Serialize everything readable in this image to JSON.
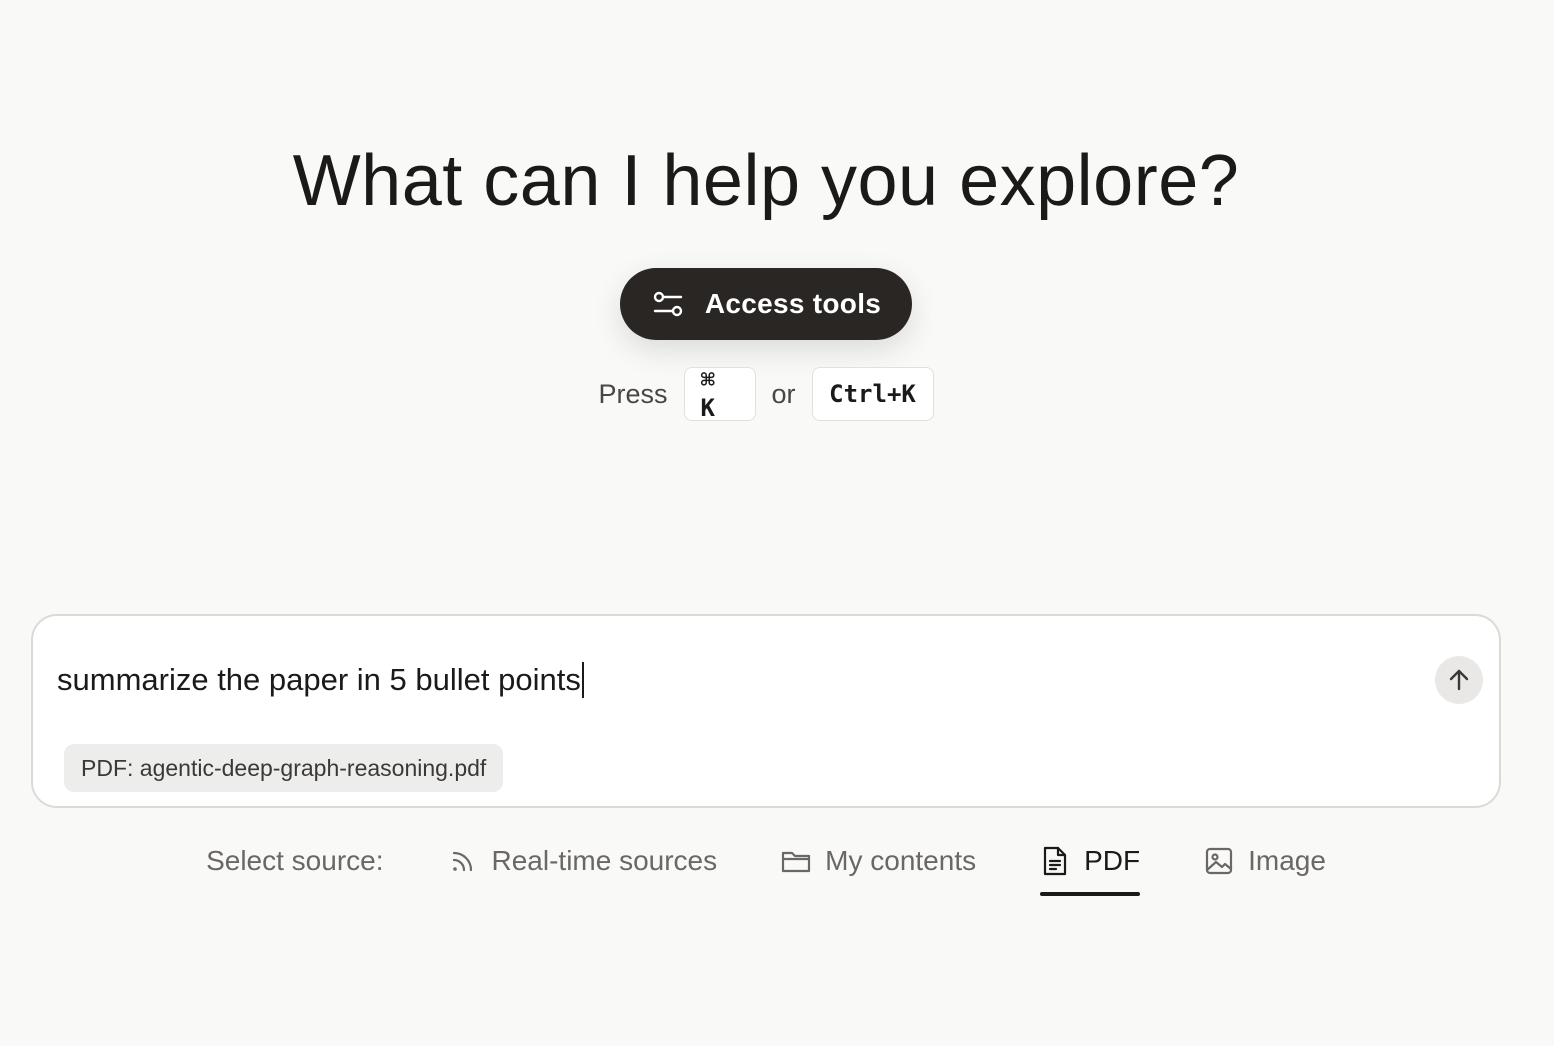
{
  "hero": {
    "title": "What can I help you explore?"
  },
  "tools_button": {
    "label": "Access tools",
    "icon": "sliders-icon"
  },
  "shortcut": {
    "press_label": "Press",
    "mac_key": "⌘ K",
    "or_label": "or",
    "pc_key": "Ctrl+K"
  },
  "composer": {
    "value": "summarize the paper in 5 bullet points",
    "send_icon": "arrow-up-icon",
    "attachment": "PDF: agentic-deep-graph-reasoning.pdf"
  },
  "sources": {
    "label": "Select source:",
    "tabs": [
      {
        "label": "Real-time sources",
        "icon": "rss-icon",
        "active": false
      },
      {
        "label": "My contents",
        "icon": "folder-icon",
        "active": false
      },
      {
        "label": "PDF",
        "icon": "document-icon",
        "active": true
      },
      {
        "label": "Image",
        "icon": "image-icon",
        "active": false
      }
    ]
  },
  "colors": {
    "background": "#f9f9f8",
    "primary_dark": "#2a2624",
    "muted_text": "#6b6764"
  }
}
